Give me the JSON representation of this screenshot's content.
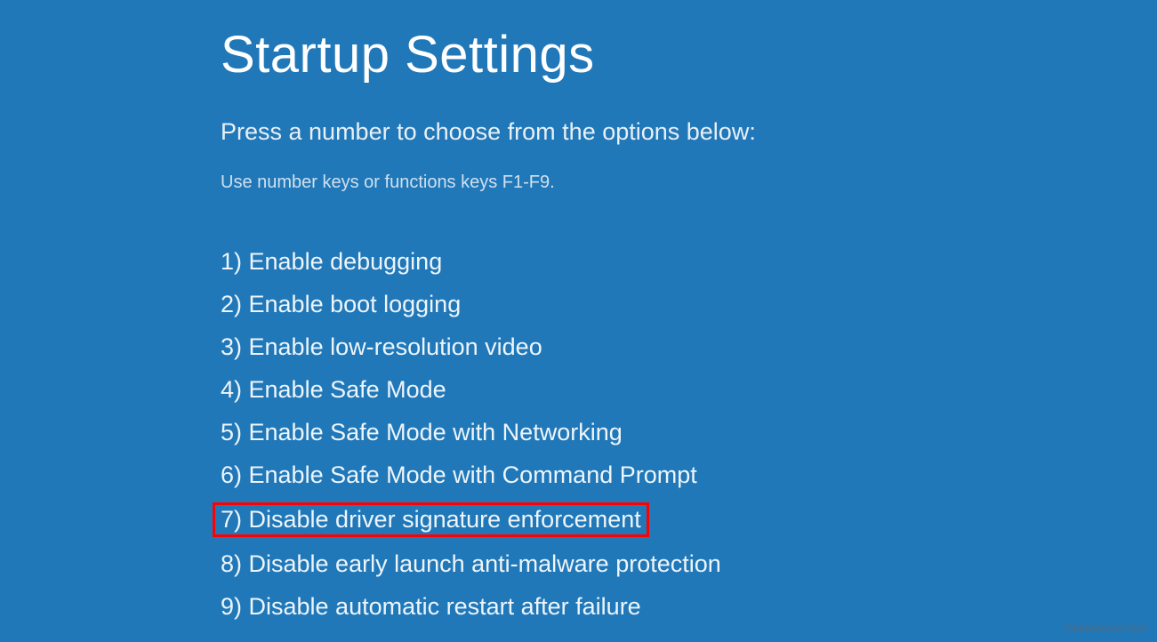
{
  "title": "Startup Settings",
  "subtitle": "Press a number to choose from the options below:",
  "hint": "Use number keys or functions keys F1-F9.",
  "options": {
    "item1": "1) Enable debugging",
    "item2": "2) Enable boot logging",
    "item3": "3) Enable low-resolution video",
    "item4": "4) Enable Safe Mode",
    "item5": "5) Enable Safe Mode with Networking",
    "item6": "6) Enable Safe Mode with Command Prompt",
    "item7": "7) Disable driver signature enforcement",
    "item8": "8) Disable early launch anti-malware protection",
    "item9": "9) Disable automatic restart after failure"
  },
  "watermark": "©Howtoconnect"
}
